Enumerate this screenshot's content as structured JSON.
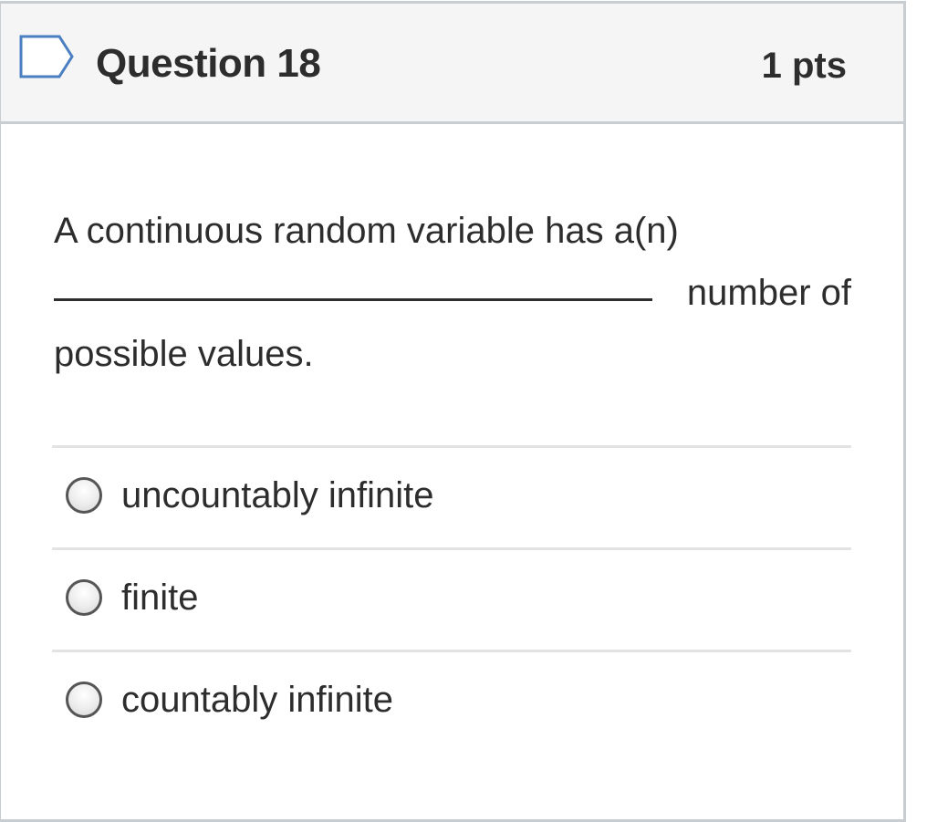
{
  "header": {
    "icon": "flag-icon",
    "title": "Question 18",
    "points": "1 pts"
  },
  "question": {
    "text_line1": "A continuous random variable has a(n)",
    "blank": "_______________________________",
    "text_line2_suffix": "number of",
    "text_line3": "possible values."
  },
  "answers": [
    {
      "label": "uncountably infinite",
      "selected": false
    },
    {
      "label": "finite",
      "selected": false
    },
    {
      "label": "countably infinite",
      "selected": false
    }
  ],
  "colors": {
    "header_bg": "#f5f5f5",
    "border": "#c7cdd1",
    "divider": "#e3e3e3",
    "flag_outline": "#4a7fc1",
    "text": "#2d2d2d"
  }
}
